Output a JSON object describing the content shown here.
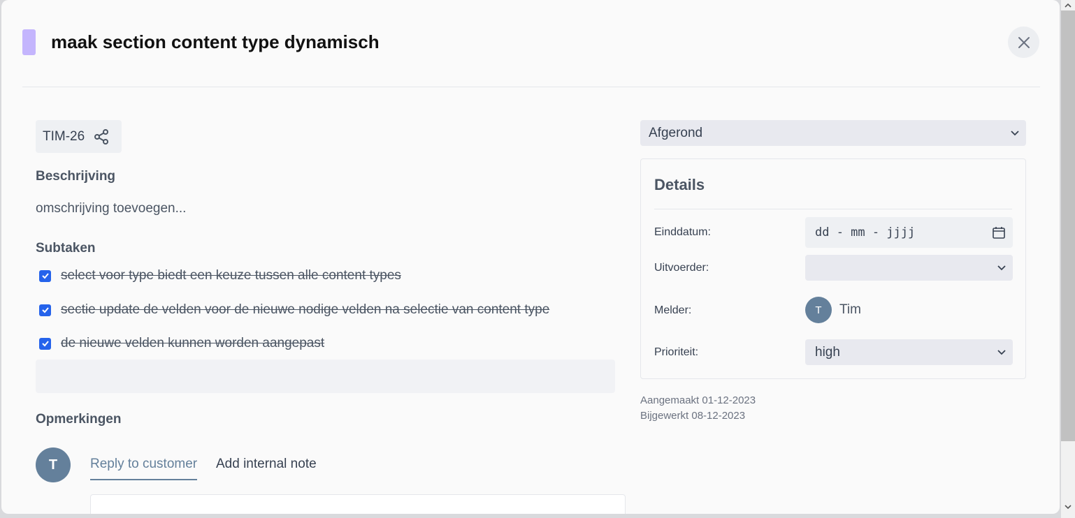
{
  "header": {
    "title": "maak section content type dynamisch",
    "tag_color": "#c4b5fd"
  },
  "ticket": {
    "id": "TIM-26"
  },
  "description": {
    "label": "Beschrijving",
    "placeholder": "omschrijving toevoegen..."
  },
  "subtasks": {
    "label": "Subtaken",
    "items": [
      {
        "text": "select voor type biedt een keuze tussen alle content types",
        "checked": true
      },
      {
        "text": "sectie update de velden voor de nieuwe nodige velden na selectie van content type",
        "checked": true
      },
      {
        "text": "de nieuwe velden kunnen worden aangepast",
        "checked": true
      }
    ]
  },
  "comments": {
    "label": "Opmerkingen",
    "avatar_initial": "T",
    "tabs": [
      {
        "label": "Reply to customer",
        "active": true
      },
      {
        "label": "Add internal note",
        "active": false
      }
    ]
  },
  "status": {
    "value": "Afgerond"
  },
  "details": {
    "title": "Details",
    "due_date_label": "Einddatum:",
    "due_date_placeholder": "dd - mm - jjjj",
    "assignee_label": "Uitvoerder:",
    "assignee_value": "",
    "reporter_label": "Melder:",
    "reporter_initial": "T",
    "reporter_name": "Tim",
    "priority_label": "Prioriteit:",
    "priority_value": "high"
  },
  "meta": {
    "created": "Aangemaakt 01-12-2023",
    "updated": "Bijgewerkt 08-12-2023"
  },
  "colors": {
    "accent": "#64809b",
    "checkbox": "#2563eb"
  }
}
